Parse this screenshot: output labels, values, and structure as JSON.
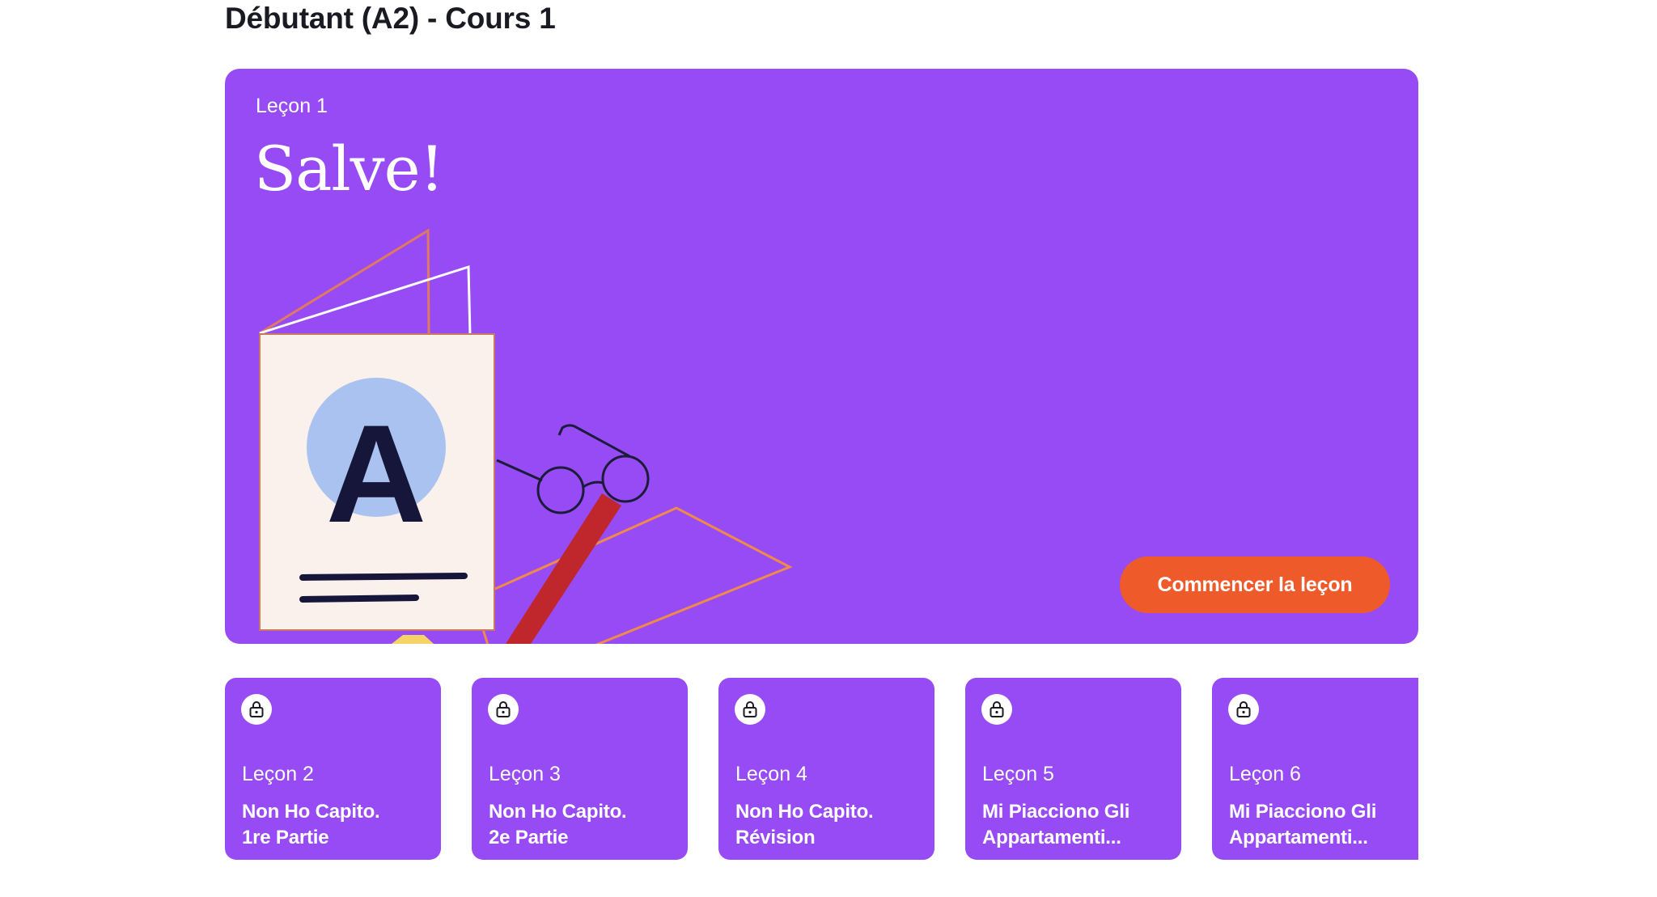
{
  "course": {
    "title": "Débutant (A2) - Cours 1"
  },
  "hero": {
    "lesson_label": "Leçon 1",
    "lesson_title": "Salve!",
    "illustration_letter": "A",
    "cta_label": "Commencer la leçon",
    "background_color": "#974bf5",
    "cta_color": "#ef5a2a"
  },
  "lessons": [
    {
      "label": "Leçon 2",
      "name_line1": "Non Ho Capito.",
      "name_line2": "1re Partie",
      "icon": "lock-icon",
      "locked": true
    },
    {
      "label": "Leçon 3",
      "name_line1": "Non Ho Capito.",
      "name_line2": "2e Partie",
      "icon": "lock-icon",
      "locked": true
    },
    {
      "label": "Leçon 4",
      "name_line1": "Non Ho Capito.",
      "name_line2": "Révision",
      "icon": "lock-icon",
      "locked": true
    },
    {
      "label": "Leçon 5",
      "name_line1": "Mi Piacciono Gli",
      "name_line2": "Appartamenti...",
      "icon": "lock-icon",
      "locked": true
    },
    {
      "label": "Leçon 6",
      "name_line1": "Mi Piacciono Gli",
      "name_line2": "Appartamenti...",
      "icon": "lock-icon",
      "locked": true
    }
  ]
}
